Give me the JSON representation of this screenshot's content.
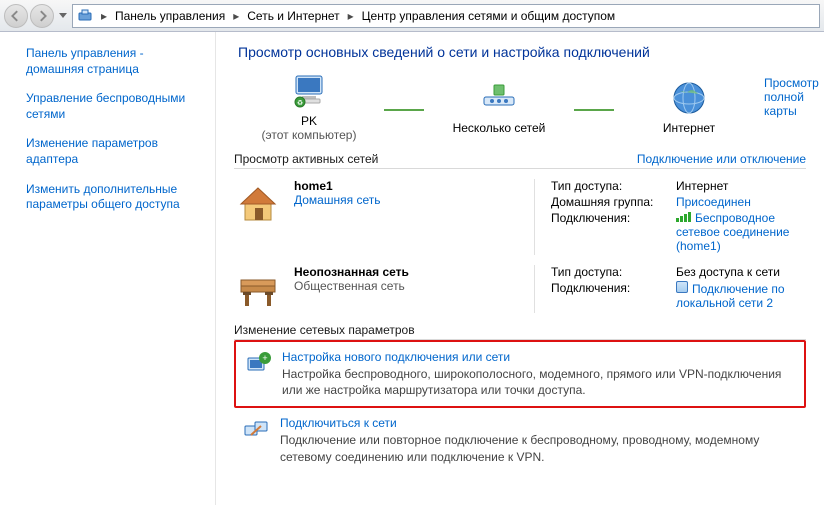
{
  "breadcrumb": {
    "items": [
      "Панель управления",
      "Сеть и Интернет",
      "Центр управления сетями и общим доступом"
    ]
  },
  "sidebar": {
    "home": "Панель управления - домашняя страница",
    "links": [
      "Управление беспроводными сетями",
      "Изменение параметров адаптера",
      "Изменить дополнительные параметры общего доступа"
    ]
  },
  "title": "Просмотр основных сведений о сети и настройка подключений",
  "map": {
    "full_map": "Просмотр полной карты",
    "pc": {
      "name": "PK",
      "sub": "(этот компьютер)"
    },
    "middle": "Несколько сетей",
    "internet": "Интернет"
  },
  "active": {
    "heading": "Просмотр активных сетей",
    "right_link": "Подключение или отключение",
    "nets": [
      {
        "name": "home1",
        "type": "Домашняя сеть",
        "type_link": true,
        "rows": [
          {
            "k": "Тип доступа:",
            "v": "Интернет",
            "link": false,
            "icon": ""
          },
          {
            "k": "Домашняя группа:",
            "v": "Присоединен",
            "link": true,
            "icon": ""
          },
          {
            "k": "Подключения:",
            "v": "Беспроводное сетевое соединение (home1)",
            "link": true,
            "icon": "wifi"
          }
        ]
      },
      {
        "name": "Неопознанная сеть",
        "type": "Общественная сеть",
        "type_link": false,
        "rows": [
          {
            "k": "Тип доступа:",
            "v": "Без доступа к сети",
            "link": false,
            "icon": ""
          },
          {
            "k": "Подключения:",
            "v": "Подключение по локальной сети 2",
            "link": true,
            "icon": "lan"
          }
        ]
      }
    ]
  },
  "change": {
    "heading": "Изменение сетевых параметров",
    "tasks": [
      {
        "title": "Настройка нового подключения или сети",
        "desc": "Настройка беспроводного, широкополосного, модемного, прямого или VPN-подключения или же настройка маршрутизатора или точки доступа.",
        "hl": true
      },
      {
        "title": "Подключиться к сети",
        "desc": "Подключение или повторное подключение к беспроводному, проводному, модемному сетевому соединению или подключение к VPN.",
        "hl": false
      }
    ]
  }
}
